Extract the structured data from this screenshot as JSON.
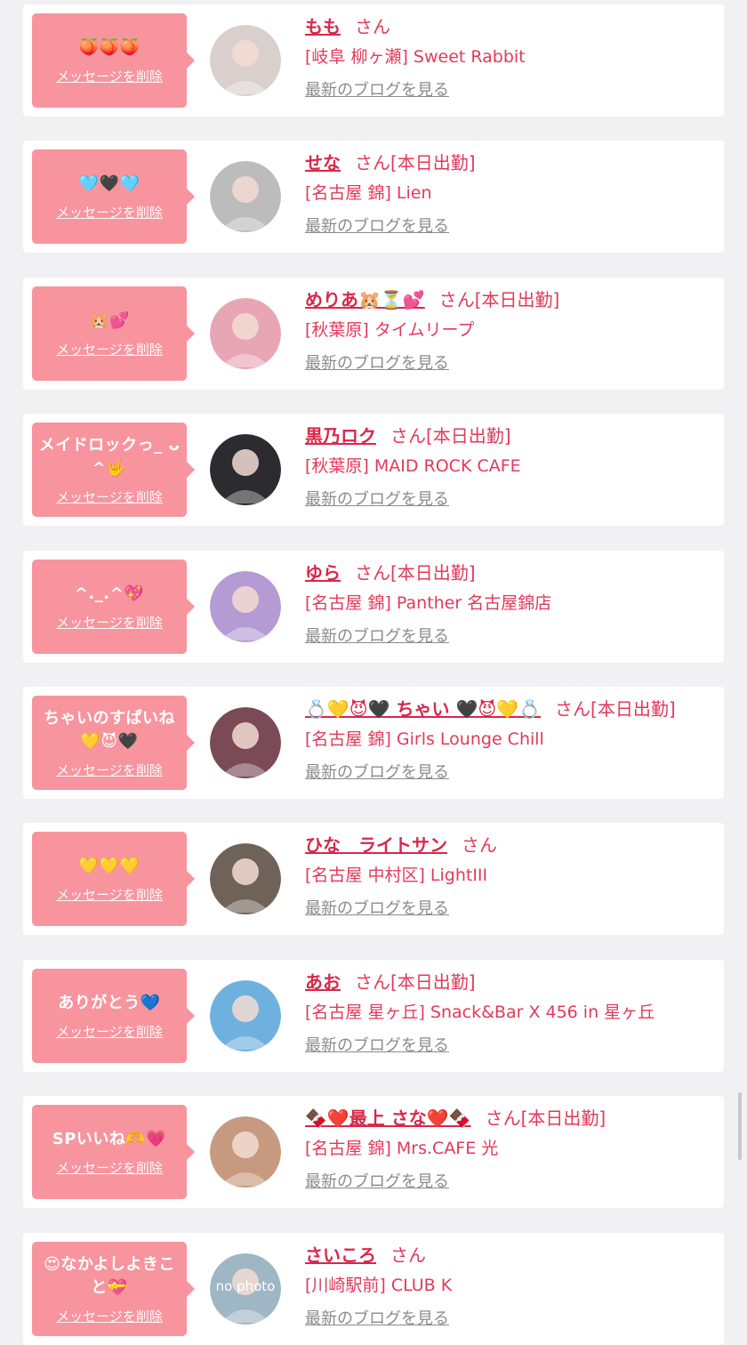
{
  "items": [
    {
      "message": "🍑🍑🍑",
      "delete_label": "メッセージを削除",
      "name": "もも",
      "honorific": "さん",
      "status": "",
      "shop": "[岐阜 柳ヶ瀬] Sweet Rabbit",
      "blog_link": "最新のブログを見る",
      "avatar_color": "#d9cfcd"
    },
    {
      "message": "🩵🖤🩵",
      "delete_label": "メッセージを削除",
      "name": "せな",
      "honorific": "さん",
      "status": "[本日出勤]",
      "shop": "[名古屋 錦] Lien",
      "blog_link": "最新のブログを見る",
      "avatar_color": "#bcbcbc"
    },
    {
      "message": "🐹💕",
      "delete_label": "メッセージを削除",
      "name": "めりあ🐹⏳💕",
      "honorific": "さん",
      "status": "[本日出勤]",
      "shop": "[秋葉原] タイムリープ",
      "blog_link": "最新のブログを見る",
      "avatar_color": "#e8a6b5"
    },
    {
      "message": "メイドロックっ_ ᴗ^🤟",
      "delete_label": "メッセージを削除",
      "name": "黒乃ロク",
      "honorific": "さん",
      "status": "[本日出勤]",
      "shop": "[秋葉原] MAID ROCK CAFE",
      "blog_link": "最新のブログを見る",
      "avatar_color": "#2b2b30"
    },
    {
      "message": "^._.^💖",
      "delete_label": "メッセージを削除",
      "name": "ゆら",
      "honorific": "さん",
      "status": "[本日出勤]",
      "shop": "[名古屋 錦] Panther 名古屋錦店",
      "blog_link": "最新のブログを見る",
      "avatar_color": "#b59bd3"
    },
    {
      "message": "ちゃいのすぱいね💛😈🖤",
      "delete_label": "メッセージを削除",
      "name": "💍💛😈🖤 ちゃい 🖤😈💛💍",
      "honorific": "さん",
      "status": "[本日出勤]",
      "shop": "[名古屋 錦] Girls Lounge Chill",
      "blog_link": "最新のブログを見る",
      "avatar_color": "#7a4a56"
    },
    {
      "message": "💛💛💛",
      "delete_label": "メッセージを削除",
      "name": "ひな　ライトサン",
      "honorific": "さん",
      "status": "",
      "shop": "[名古屋 中村区] LightIII",
      "blog_link": "最新のブログを見る",
      "avatar_color": "#6f6258"
    },
    {
      "message": "ありがとう💙",
      "delete_label": "メッセージを削除",
      "name": "あお",
      "honorific": "さん",
      "status": "[本日出勤]",
      "shop": "[名古屋 星ヶ丘] Snack&Bar X 456 in 星ヶ丘",
      "blog_link": "最新のブログを見る",
      "avatar_color": "#6fb1de"
    },
    {
      "message": "SPいいね🫶💗",
      "delete_label": "メッセージを削除",
      "name": "🍫❤️最上 さな❤️🍫",
      "honorific": "さん",
      "status": "[本日出勤]",
      "shop": "[名古屋 錦] Mrs.CAFE 光",
      "blog_link": "最新のブログを見る",
      "avatar_color": "#c79a7f"
    },
    {
      "message": "😍なかよしよきこと💝",
      "delete_label": "メッセージを削除",
      "name": "さいころ",
      "honorific": "さん",
      "status": "",
      "shop": "[川崎駅前] CLUB K",
      "blog_link": "最新のブログを見る",
      "avatar_color": "#9fb6c4",
      "avatar_text": "no photo"
    }
  ]
}
